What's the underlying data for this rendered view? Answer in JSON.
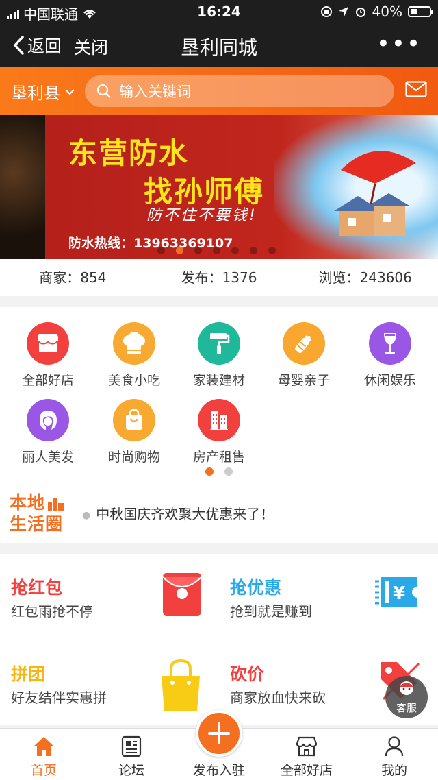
{
  "status_bar": {
    "carrier": "中国联通",
    "time": "16:24",
    "battery": "40%",
    "battery_level": 0.4
  },
  "nav": {
    "back_label": "返回",
    "close_label": "关闭",
    "title": "垦利同城",
    "more": "•••"
  },
  "header": {
    "county": "垦利县",
    "search_placeholder": "输入关键词"
  },
  "banner": {
    "headline1": "东营防水",
    "headline2": "找孙师傅",
    "slogan": "防不住不要钱!",
    "hotline": "防水热线：13963369107",
    "slide_count": 7,
    "active_slide": 1
  },
  "stats": [
    {
      "label": "商家：854"
    },
    {
      "label": "发布：1376"
    },
    {
      "label": "浏览：243606"
    }
  ],
  "categories": [
    {
      "label": "全部好店",
      "icon": "shop-icon",
      "color": "#f2403f"
    },
    {
      "label": "美食小吃",
      "icon": "chef-hat-icon",
      "color": "#f8a931"
    },
    {
      "label": "家装建材",
      "icon": "paint-roller-icon",
      "color": "#1fb89a"
    },
    {
      "label": "母婴亲子",
      "icon": "baby-bottle-icon",
      "color": "#f9a72f"
    },
    {
      "label": "休闲娱乐",
      "icon": "wine-glass-icon",
      "color": "#9a56e4"
    },
    {
      "label": "丽人美发",
      "icon": "woman-hair-icon",
      "color": "#9a56e4"
    },
    {
      "label": "时尚购物",
      "icon": "shopping-bag-icon",
      "color": "#f8a931"
    },
    {
      "label": "房产租售",
      "icon": "building-icon",
      "color": "#f2403f"
    }
  ],
  "notice": {
    "logo_line1": "本地",
    "logo_line2": "生活圈",
    "text": "中秋国庆齐欢聚大优惠来了！"
  },
  "promos": [
    {
      "title": "抢红包",
      "subtitle": "红包雨抢不停",
      "color": "#f2403f",
      "icon": "red-envelope-icon"
    },
    {
      "title": "抢优惠",
      "subtitle": "抢到就是赚到",
      "color": "#2aa9e8",
      "icon": "coupon-icon"
    },
    {
      "title": "拼团",
      "subtitle": "好友结伴实惠拼",
      "color": "#f8b614",
      "icon": "shopping-bag-icon"
    },
    {
      "title": "砍价",
      "subtitle": "商家放血快来砍",
      "color": "#f2403f",
      "icon": "price-tag-icon"
    }
  ],
  "service": {
    "label": "客服"
  },
  "tabbar": [
    {
      "label": "首页",
      "icon": "home-icon",
      "active": true
    },
    {
      "label": "论坛",
      "icon": "forum-icon",
      "active": false
    },
    {
      "label": "发布入驻",
      "icon": "plus-icon",
      "active": false
    },
    {
      "label": "全部好店",
      "icon": "store-icon",
      "active": false
    },
    {
      "label": "我的",
      "icon": "user-icon",
      "active": false
    }
  ],
  "colors": {
    "accent": "#f47020",
    "nav_bg": "#1e1e1e"
  }
}
